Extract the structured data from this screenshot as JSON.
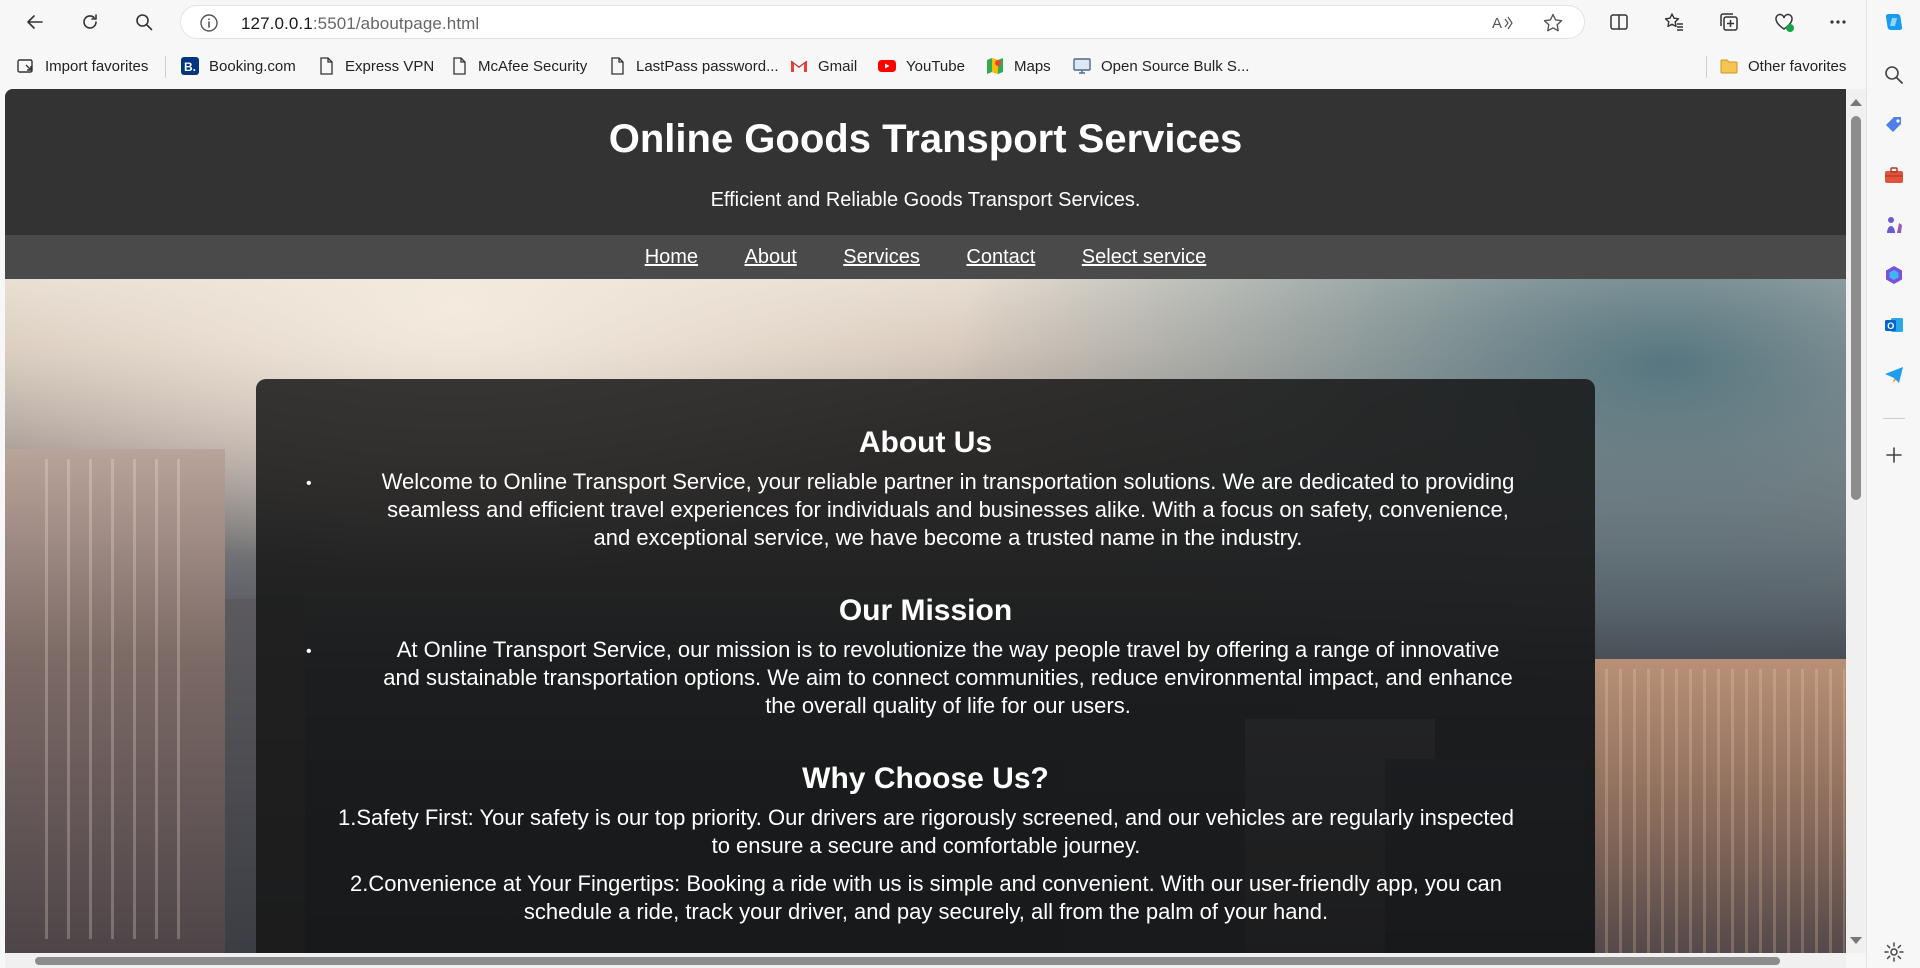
{
  "browser": {
    "url_host": "127.0.0.1",
    "url_rest": ":5501/aboutpage.html"
  },
  "favorites": {
    "items": [
      {
        "label": "Import favorites",
        "icon": "import-icon"
      },
      {
        "label": "Booking.com",
        "icon": "booking-icon"
      },
      {
        "label": "Express VPN",
        "icon": "page-icon"
      },
      {
        "label": "McAfee Security",
        "icon": "page-icon"
      },
      {
        "label": "LastPass password...",
        "icon": "page-icon"
      },
      {
        "label": "Gmail",
        "icon": "gmail-icon"
      },
      {
        "label": "YouTube",
        "icon": "youtube-icon"
      },
      {
        "label": "Maps",
        "icon": "maps-icon"
      },
      {
        "label": "Open Source Bulk S...",
        "icon": "monitor-icon"
      }
    ],
    "other": "Other favorites"
  },
  "site": {
    "title": "Online Goods Transport Services",
    "tagline": "Efficient and Reliable Goods Transport Services.",
    "nav": [
      "Home",
      "About",
      "Services",
      "Contact",
      "Select service"
    ]
  },
  "about": {
    "heading": "About Us",
    "text_lines": [
      "Welcome to Online Transport Service, your reliable partner in transportation solutions. We are dedicated to providing",
      "seamless and efficient travel experiences for individuals and businesses alike. With a focus on safety, convenience,",
      "and exceptional service, we have become a trusted name in the industry."
    ]
  },
  "mission": {
    "heading": "Our Mission",
    "text_lines": [
      "At Online Transport Service, our mission is to revolutionize the way people travel by offering a range of innovative",
      "and sustainable transportation options. We aim to connect communities, reduce environmental impact, and enhance",
      "the overall quality of life for our users."
    ]
  },
  "why": {
    "heading": "Why Choose Us?",
    "point1_lines": [
      "1.Safety First: Your safety is our top priority. Our drivers are rigorously screened, and our vehicles are regularly inspected",
      "to ensure a secure and comfortable journey."
    ],
    "point2_lines": [
      "2.Convenience at Your Fingertips: Booking a ride with us is simple and convenient. With our user-friendly app, you can",
      "schedule a ride, track your driver, and pay securely, all from the palm of your hand."
    ]
  },
  "bullet_glyph": "•",
  "colors": {
    "header_bg": "#333333",
    "nav_bg": "#4a4a4a",
    "card_bg": "rgba(22,22,22,0.85)",
    "edge_accent": "#1b9bf0"
  }
}
